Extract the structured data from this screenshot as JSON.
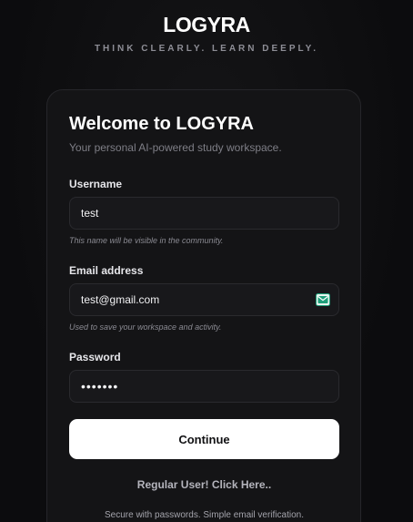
{
  "header": {
    "brand": "LOGYRA",
    "tagline": "THINK CLEARLY. LEARN DEEPLY."
  },
  "card": {
    "title": "Welcome to LOGYRA",
    "subtitle": "Your personal AI-powered study workspace."
  },
  "form": {
    "username": {
      "label": "Username",
      "value": "test",
      "hint": "This name will be visible in the community."
    },
    "email": {
      "label": "Email address",
      "value": "test@gmail.com",
      "hint": "Used to save your workspace and activity.",
      "icon": "mail-icon"
    },
    "password": {
      "label": "Password",
      "value": "1234567"
    }
  },
  "actions": {
    "continue_label": "Continue",
    "regular_user_link": "Regular User! Click Here.."
  },
  "footer": {
    "note": "Secure with passwords. Simple email verification."
  },
  "colors": {
    "background": "#0c0c0e",
    "card": "#141416",
    "field": "#18181b",
    "button": "#ffffff",
    "mail_icon": "#1f9e7a"
  }
}
